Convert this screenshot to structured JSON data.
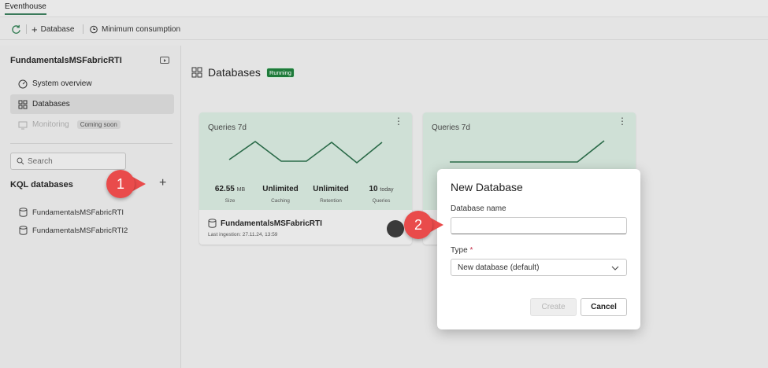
{
  "tab": {
    "label": "Eventhouse"
  },
  "toolbar": {
    "add_database_label": "Database",
    "min_consumption_label": "Minimum consumption"
  },
  "sidebar": {
    "title": "FundamentalsMSFabricRTI",
    "nav": [
      {
        "label": "System overview",
        "icon": "gauge-icon"
      },
      {
        "label": "Databases",
        "icon": "grid-icon"
      },
      {
        "label": "Monitoring",
        "icon": "monitor-icon",
        "badge": "Coming soon"
      }
    ],
    "search_placeholder": "Search",
    "kql_header": "KQL databases",
    "databases": [
      "FundamentalsMSFabricRTI",
      "FundamentalsMSFabricRTI2"
    ]
  },
  "main": {
    "title": "Databases",
    "status": "Running",
    "cards": [
      {
        "queries_label": "Queries 7d",
        "stats": [
          {
            "value": "62.55",
            "unit": "MB",
            "label": "Size"
          },
          {
            "value": "Unlimited",
            "unit": "",
            "label": "Caching"
          },
          {
            "value": "Unlimited",
            "unit": "",
            "label": "Retention"
          },
          {
            "value": "10",
            "unit": "today",
            "label": "Queries"
          }
        ],
        "name": "FundamentalsMSFabricRTI",
        "last_ingestion": "Last ingestion: 27.11.24, 13:59"
      },
      {
        "queries_label": "Queries 7d"
      }
    ]
  },
  "dialog": {
    "title": "New Database",
    "name_label": "Database name",
    "name_value": "",
    "type_label": "Type",
    "required_mark": "*",
    "type_value": "New database (default)",
    "create_label": "Create",
    "cancel_label": "Cancel"
  },
  "callouts": {
    "one": "1",
    "two": "2"
  },
  "colors": {
    "accent": "#1e7a3a",
    "callout": "#e94b4b",
    "card_top": "#cfe0d6"
  }
}
